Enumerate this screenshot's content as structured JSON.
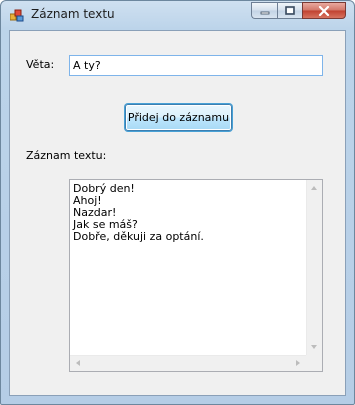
{
  "window": {
    "title": "Záznam textu",
    "controls": {
      "minimize_icon": "minimize-icon",
      "maximize_icon": "maximize-icon",
      "close_icon": "close-icon"
    }
  },
  "form": {
    "veta_label": "Věta:",
    "veta_value": "A ty?",
    "add_button_label": "Přidej do záznamu",
    "zaznam_label": "Záznam textu:",
    "log_lines": [
      "Dobrý den!",
      "Ahoj!",
      "Nazdar!",
      "Jak se máš?",
      "Dobře, děkuji za optání."
    ]
  },
  "colors": {
    "title_bar": "#bcd4ea",
    "client_bg": "#f0f0f0",
    "close_button": "#c0402f",
    "focus_border": "#7eb4ea"
  }
}
